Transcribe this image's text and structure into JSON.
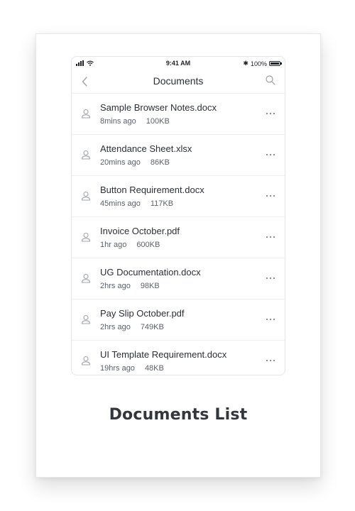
{
  "status_bar": {
    "time": "9:41 AM",
    "battery": "100%"
  },
  "nav": {
    "title": "Documents"
  },
  "documents": [
    {
      "name": "Sample Browser Notes.docx",
      "time": "8mins ago",
      "size": "100KB"
    },
    {
      "name": "Attendance Sheet.xlsx",
      "time": "20mins ago",
      "size": "86KB"
    },
    {
      "name": "Button Requirement.docx",
      "time": "45mins ago",
      "size": "117KB"
    },
    {
      "name": "Invoice October.pdf",
      "time": "1hr ago",
      "size": "600KB"
    },
    {
      "name": "UG Documentation.docx",
      "time": "2hrs ago",
      "size": "98KB"
    },
    {
      "name": "Pay Slip October.pdf",
      "time": "2hrs ago",
      "size": "749KB"
    },
    {
      "name": "UI Template Requirement.docx",
      "time": "19hrs ago",
      "size": "48KB"
    }
  ],
  "caption": "Documents List",
  "icons": {
    "back": "chevron-left-icon",
    "search": "search-icon",
    "row": "user-icon",
    "more": "more-horizontal-icon"
  },
  "colors": {
    "text": "#2b2f38",
    "meta": "#5b606b",
    "icon": "#a0a4ab",
    "divider": "#eceef1"
  }
}
